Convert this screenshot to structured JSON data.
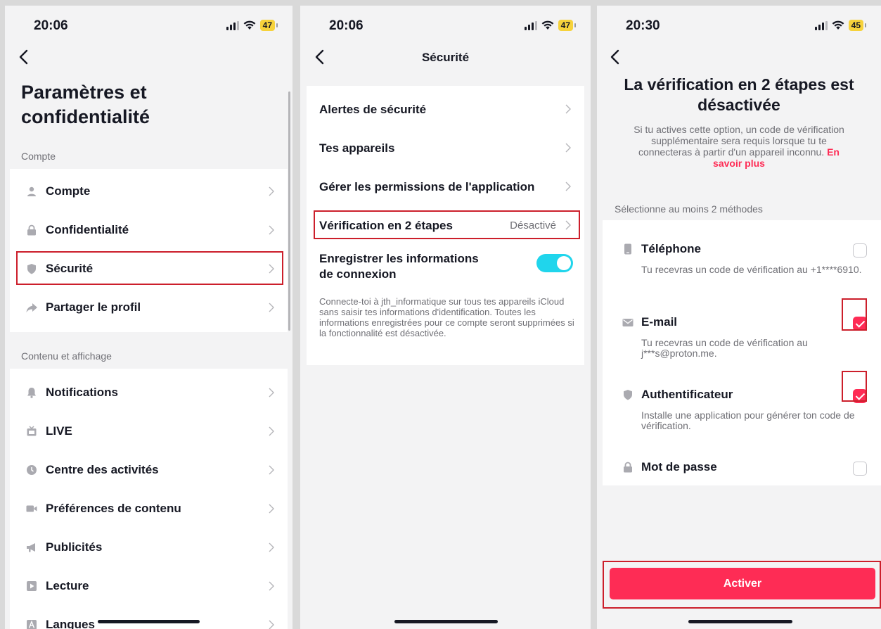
{
  "screen1": {
    "time": "20:06",
    "battery": "47",
    "title": "Paramètres et confidentialité",
    "section_account": "Compte",
    "account_items": [
      {
        "label": "Compte",
        "icon": "person-icon"
      },
      {
        "label": "Confidentialité",
        "icon": "lock-icon"
      },
      {
        "label": "Sécurité",
        "icon": "shield-icon"
      },
      {
        "label": "Partager le profil",
        "icon": "share-icon"
      }
    ],
    "section_content": "Contenu et affichage",
    "content_items": [
      {
        "label": "Notifications",
        "icon": "bell-icon"
      },
      {
        "label": "LIVE",
        "icon": "live-tv-icon"
      },
      {
        "label": "Centre des activités",
        "icon": "clock-icon"
      },
      {
        "label": "Préférences de contenu",
        "icon": "video-icon"
      },
      {
        "label": "Publicités",
        "icon": "megaphone-icon"
      },
      {
        "label": "Lecture",
        "icon": "play-icon"
      },
      {
        "label": "Langues",
        "icon": "language-icon"
      }
    ]
  },
  "screen2": {
    "time": "20:06",
    "battery": "47",
    "title": "Sécurité",
    "items": [
      {
        "label": "Alertes de sécurité"
      },
      {
        "label": "Tes appareils"
      },
      {
        "label": "Gérer les permissions de l'application"
      },
      {
        "label": "Vérification en 2 étapes",
        "value": "Désactivé"
      }
    ],
    "save_login_label": "Enregistrer les informations de connexion",
    "save_login_on": true,
    "save_login_desc": "Connecte-toi à jth_informatique sur tous tes appareils iCloud sans saisir tes informations d'identification. Toutes les informations enregistrées pour ce compte seront supprimées si la fonctionnalité est désactivée."
  },
  "screen3": {
    "time": "20:30",
    "battery": "45",
    "title": "La vérification en 2 étapes est désactivée",
    "subtitle": "Si tu actives cette option, un code de vérification supplémentaire sera requis lorsque tu te connecteras à partir d'un appareil inconnu.",
    "learn_more": "En savoir plus",
    "section": "Sélectionne au moins 2 méthodes",
    "methods": [
      {
        "label": "Téléphone",
        "desc": "Tu recevras un code de vérification au +1****6910.",
        "checked": false,
        "icon": "phone-icon"
      },
      {
        "label": "E-mail",
        "desc": "Tu recevras un code de vérification au j***s@proton.me.",
        "checked": true,
        "icon": "mail-icon"
      },
      {
        "label": "Authentificateur",
        "desc": "Installe une application pour générer ton code de vérification.",
        "checked": true,
        "icon": "shield-icon"
      },
      {
        "label": "Mot de passe",
        "desc": "",
        "checked": false,
        "icon": "lock-icon"
      }
    ],
    "activate_label": "Activer"
  },
  "colors": {
    "accent": "#fe2c55",
    "toggle": "#20d5ec",
    "highlight": "#cc1f2b",
    "battery": "#f6d23b"
  }
}
